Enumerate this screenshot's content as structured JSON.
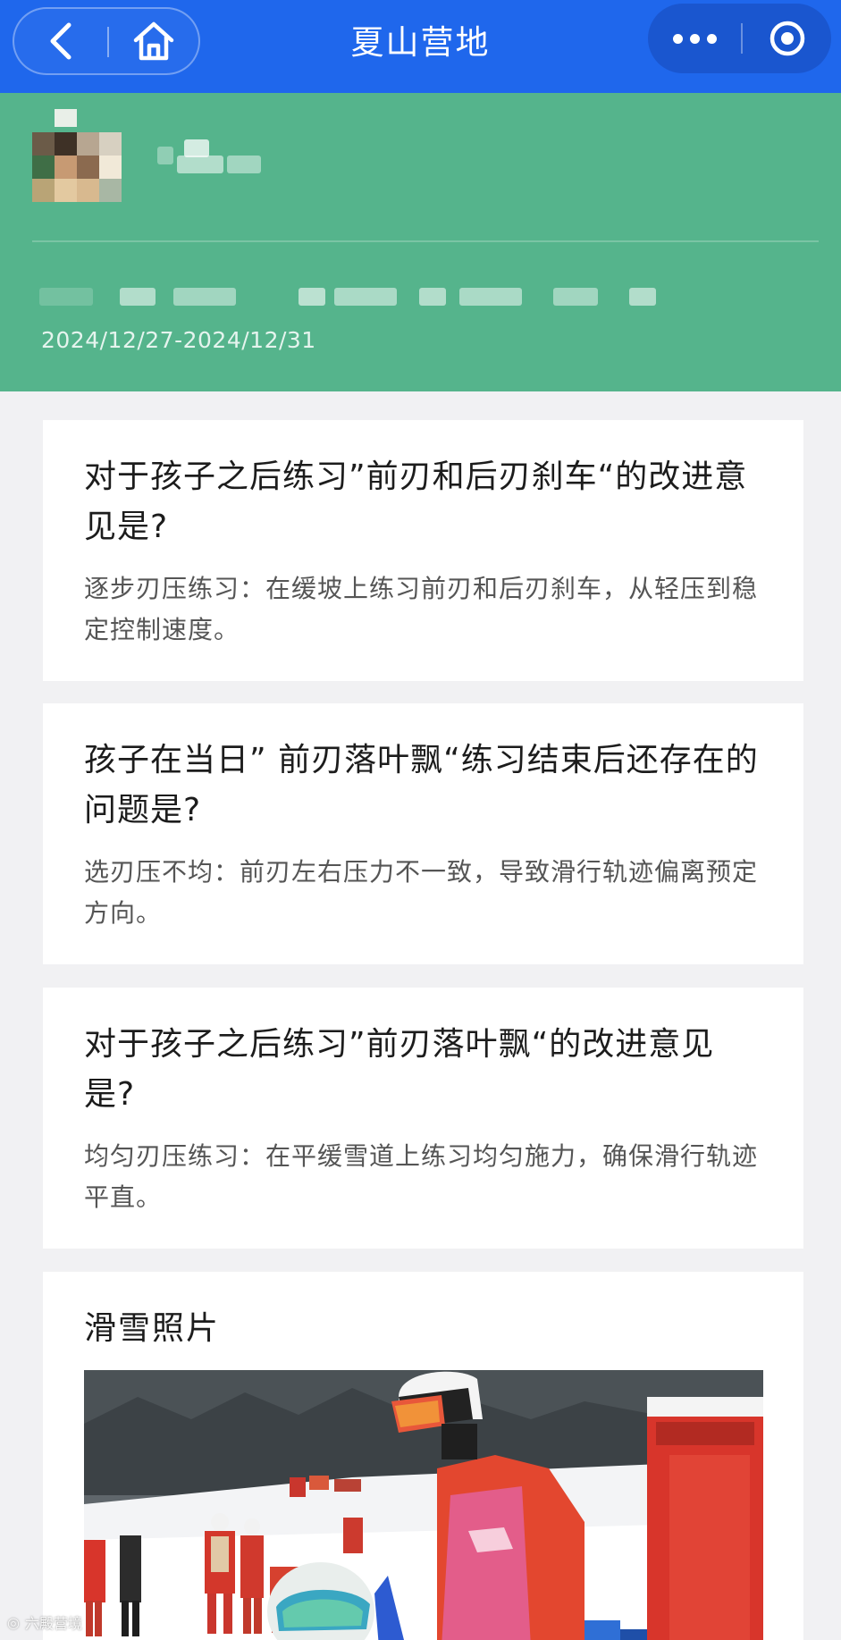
{
  "navbar": {
    "title": "夏山营地",
    "icons": [
      "chevron-left-icon",
      "home-icon",
      "more-dots-icon",
      "target-circle-icon"
    ]
  },
  "header": {
    "date_range": "2024/12/27-2024/12/31",
    "background_color": "#55b48c"
  },
  "cards": [
    {
      "question": "对于孩子之后练习”前刃和后刃刹车“的改进意见是?",
      "answer": "逐步刃压练习：在缓坡上练习前刃和后刃刹车，从轻压到稳定控制速度。"
    },
    {
      "question": "孩子在当日” 前刃落叶飘“练习结束后还存在的问题是?",
      "answer": "选刃压不均：前刃左右压力不一致，导致滑行轨迹偏离预定方向。"
    },
    {
      "question": "对于孩子之后练习”前刃落叶飘“的改进意见是?",
      "answer": "均匀刃压练习：在平缓雪道上练习均匀施力，确保滑行轨迹平直。"
    }
  ],
  "photo_section": {
    "title": "滑雪照片"
  },
  "watermark": {
    "text": "六殿营境"
  },
  "colors": {
    "navbar": "#1f67ec",
    "page_background": "#f1f1f3"
  }
}
